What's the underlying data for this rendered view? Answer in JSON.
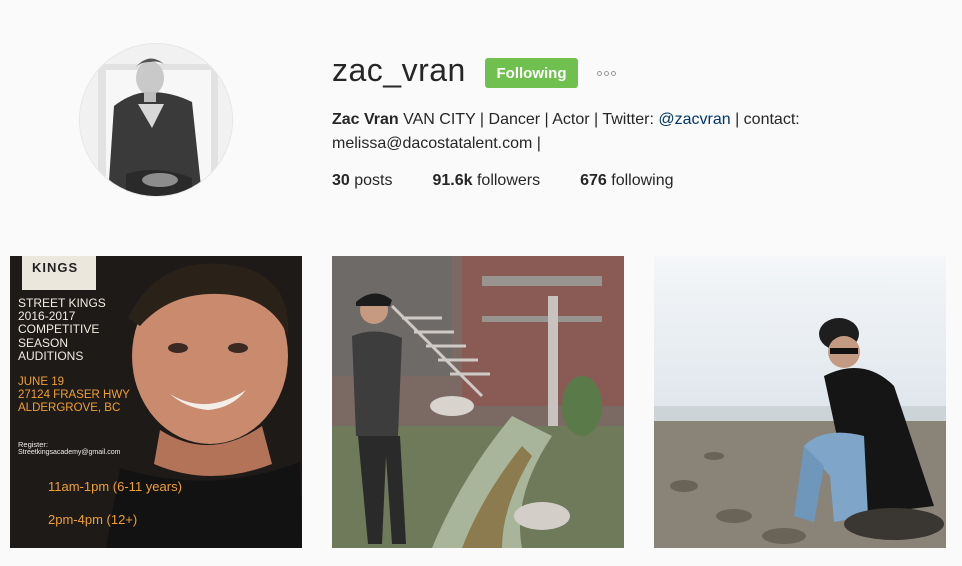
{
  "profile": {
    "username": "zac_vran",
    "follow_button": "Following",
    "more_icon": "ellipsis-icon",
    "bio": {
      "name": "Zac Vran",
      "text1": " VAN CITY | Dancer | Actor | Twitter: ",
      "twitter": "@zacvran",
      "text2": " | contact:",
      "line2": "melissa@dacostatalent.com |"
    },
    "stats": {
      "posts_count": "30",
      "posts_label": " posts",
      "followers_count": "91.6k",
      "followers_label": " followers",
      "following_count": "676",
      "following_label": " following"
    }
  },
  "posts": {
    "p1": {
      "logo": "KINGS",
      "lines": [
        "STREET KINGS",
        "2016-2017",
        "COMPETITIVE",
        "SEASON",
        "AUDITIONS"
      ],
      "date": "JUNE 19",
      "address1": "27124 FRASER HWY",
      "address2": "ALDERGROVE, BC",
      "register_label": "Register:",
      "register_email": "Streetkingsacademy@gmail.com",
      "time1": "11am-1pm (6-11 years)",
      "time2": "2pm-4pm (12+)"
    }
  },
  "colors": {
    "following_button": "#70c050",
    "link": "#003569",
    "flyer_orange": "#f0a030"
  }
}
